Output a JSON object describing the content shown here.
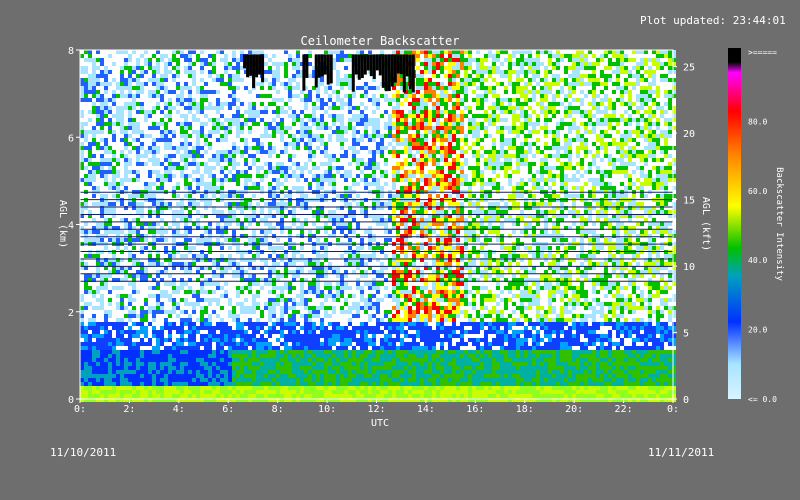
{
  "header": {
    "plot_updated": "Plot updated: 23:44:01"
  },
  "dates": {
    "start": "11/10/2011",
    "end": "11/11/2011"
  },
  "chart_data": {
    "type": "heatmap",
    "title": "Ceilometer Backscatter",
    "xlabel": "UTC",
    "ylabel_left": "AGL (km)",
    "ylabel_right": "AGL (kft)",
    "xlim": [
      0,
      24
    ],
    "ylim_km": [
      0,
      8
    ],
    "ylim_kft": [
      0,
      26.25
    ],
    "x_ticks": [
      "0:",
      "2:",
      "4:",
      "6:",
      "8:",
      "10:",
      "12:",
      "14:",
      "16:",
      "18:",
      "20:",
      "22:",
      "0:"
    ],
    "x_tick_values": [
      0,
      2,
      4,
      6,
      8,
      10,
      12,
      14,
      16,
      18,
      20,
      22,
      24
    ],
    "y_ticks_km": [
      "0",
      "2",
      "4",
      "6",
      "8"
    ],
    "y_tick_values_km": [
      0,
      2,
      4,
      6,
      8
    ],
    "y_ticks_kft": [
      "0",
      "5",
      "10",
      "15",
      "20",
      "25"
    ],
    "y_tick_values_kft": [
      0,
      5,
      10,
      15,
      20,
      25
    ],
    "colorbar": {
      "label": "Backscatter Intensity",
      "ticks": [
        ">=====",
        "80.0",
        "60.0",
        "40.0",
        "20.0",
        "<= 0.0"
      ],
      "tick_values": [
        100,
        80,
        60,
        40,
        20,
        0
      ],
      "colors": [
        "#c0f0ff",
        "#a0e0ff",
        "#0038ff",
        "#00a0ff",
        "#00c000",
        "#c8ff00",
        "#ffff00",
        "#ff8000",
        "#ff0000",
        "#ff00ff",
        "#000000"
      ]
    },
    "features": {
      "surface_layer_km": [
        0,
        1.2
      ],
      "horizontal_noise_lines_km": [
        2.7,
        4.9
      ],
      "cloud_tops_utc": [
        [
          6.6,
          7.4
        ],
        [
          9.0,
          9.2
        ],
        [
          9.5,
          10.2
        ],
        [
          11.0,
          13.5
        ]
      ],
      "noise_column_utc": [
        12.5,
        15.5
      ]
    },
    "colors": {
      "background": "#6e6e6e",
      "text": "#ffffff"
    }
  }
}
